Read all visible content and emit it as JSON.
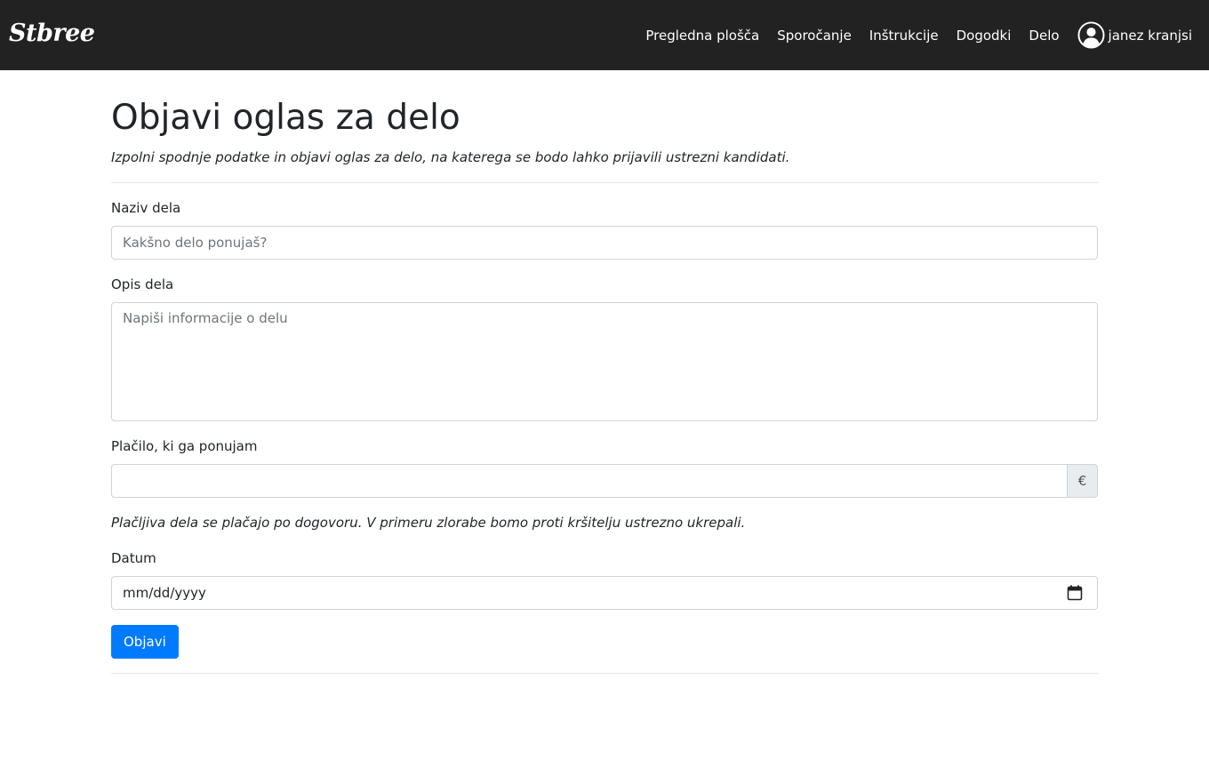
{
  "navbar": {
    "logo": "Stbree",
    "links": [
      "Pregledna plošča",
      "Sporočanje",
      "Inštrukcije",
      "Dogodki",
      "Delo"
    ],
    "user": "janez kranjsi",
    "user_icon": "user-circle-icon"
  },
  "page": {
    "title": "Objavi oglas za delo",
    "subtitle": "Izpolni spodnje podatke in objavi oglas za delo, na katerega se bodo lahko prijavili ustrezni kandidati."
  },
  "form": {
    "naziv_label": "Naziv dela",
    "naziv_placeholder": "Kakšno delo ponujaš?",
    "naziv_value": "",
    "opis_label": "Opis dela",
    "opis_placeholder": "Napiši informacije o delu",
    "opis_value": "",
    "placilo_label": "Plačilo, ki ga ponujam",
    "placilo_value": "",
    "currency": "€",
    "payment_note": "Plačljiva dela se plačajo po dogovoru. V primeru zlorabe bomo proti kršitelju ustrezno ukrepali.",
    "datum_label": "Datum",
    "datum_placeholder": "mm/dd/yyyy",
    "calendar_icon": "calendar-icon",
    "submit_label": "Objavi"
  },
  "colors": {
    "navbar_bg": "#222222",
    "primary": "#007bff"
  }
}
